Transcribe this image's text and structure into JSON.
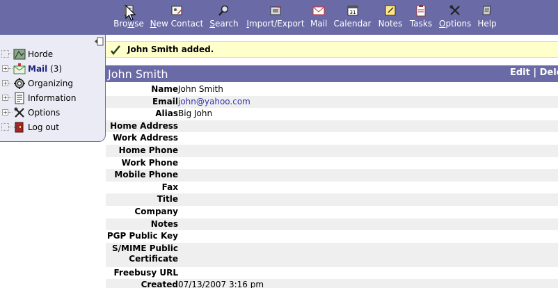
{
  "toolbar": {
    "items": [
      {
        "name": "browse",
        "pre": "Bro",
        "u": "w",
        "post": "se",
        "icon": "browse-icon"
      },
      {
        "name": "new-contact",
        "pre": "",
        "u": "N",
        "post": "ew Contact",
        "icon": "new-contact-icon"
      },
      {
        "name": "search",
        "pre": "",
        "u": "S",
        "post": "earch",
        "icon": "search-icon"
      },
      {
        "name": "import-export",
        "pre": "",
        "u": "I",
        "post": "mport/Export",
        "icon": "import-export-icon"
      },
      {
        "name": "mail",
        "pre": "",
        "u": "",
        "post": "Mail",
        "icon": "mail-icon"
      },
      {
        "name": "calendar",
        "pre": "",
        "u": "",
        "post": "Calendar",
        "icon": "calendar-icon"
      },
      {
        "name": "notes",
        "pre": "",
        "u": "",
        "post": "Notes",
        "icon": "notes-icon"
      },
      {
        "name": "tasks",
        "pre": "",
        "u": "",
        "post": "Tasks",
        "icon": "tasks-icon"
      },
      {
        "name": "options",
        "pre": "",
        "u": "O",
        "post": "ptions",
        "icon": "options-icon"
      },
      {
        "name": "help",
        "pre": "",
        "u": "",
        "post": "Help",
        "icon": "help-icon"
      }
    ]
  },
  "sidebar": {
    "items": [
      {
        "label": "Horde",
        "expand": "",
        "bold": false,
        "icon": "horde-icon"
      },
      {
        "label": "Mail",
        "count": " (3)",
        "expand": "+",
        "bold": true,
        "icon": "mail-icon"
      },
      {
        "label": "Organizing",
        "expand": "+",
        "bold": false,
        "icon": "organizing-icon"
      },
      {
        "label": "Information",
        "expand": "+",
        "bold": false,
        "icon": "information-icon"
      },
      {
        "label": "Options",
        "expand": "+",
        "bold": false,
        "icon": "options-icon"
      },
      {
        "label": "Log out",
        "expand": "",
        "bold": false,
        "icon": "logout-icon"
      }
    ]
  },
  "notice": {
    "message": "John Smith added."
  },
  "contact": {
    "title": "John Smith",
    "actions": "Edit | Dele"
  },
  "details": [
    {
      "label": "Name",
      "value": "John Smith",
      "link": false
    },
    {
      "label": "Email",
      "value": "john@yahoo.com",
      "link": true
    },
    {
      "label": "Alias",
      "value": "Big John",
      "link": false
    },
    {
      "label": "Home Address",
      "value": "",
      "link": false
    },
    {
      "label": "Work Address",
      "value": "",
      "link": false
    },
    {
      "label": "Home Phone",
      "value": "",
      "link": false
    },
    {
      "label": "Work Phone",
      "value": "",
      "link": false
    },
    {
      "label": "Mobile Phone",
      "value": "",
      "link": false
    },
    {
      "label": "Fax",
      "value": "",
      "link": false
    },
    {
      "label": "Title",
      "value": "",
      "link": false
    },
    {
      "label": "Company",
      "value": "",
      "link": false
    },
    {
      "label": "Notes",
      "value": "",
      "link": false
    },
    {
      "label": "PGP Public Key",
      "value": "",
      "link": false
    },
    {
      "label": "S/MIME Public Certificate",
      "value": "",
      "link": false
    },
    {
      "label": "Freebusy URL",
      "value": "",
      "link": false
    },
    {
      "label": "Created",
      "value": "07/13/2007 3:16 pm",
      "link": false
    }
  ]
}
